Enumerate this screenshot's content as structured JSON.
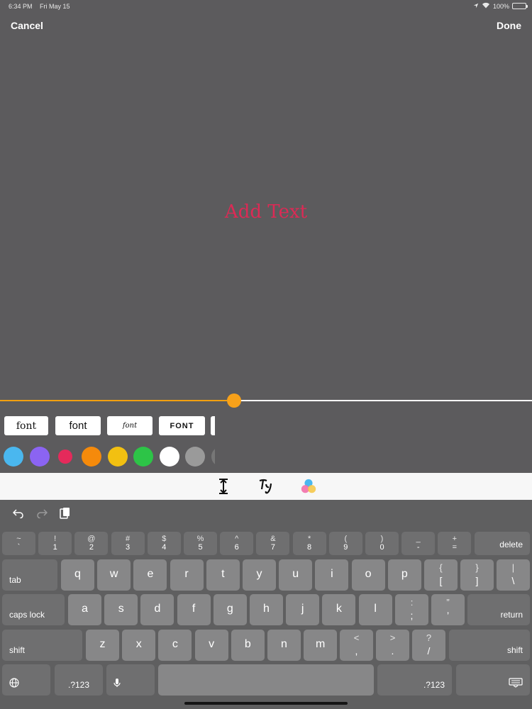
{
  "status_bar": {
    "time": "6:34 PM",
    "date": "Fri May 15",
    "battery": "100%"
  },
  "nav": {
    "cancel_label": "Cancel",
    "done_label": "Done"
  },
  "canvas": {
    "text": "Add Text",
    "text_color": "#dc2a55"
  },
  "size_slider": {
    "value_fraction": 0.44,
    "accent_color": "#f7a11a"
  },
  "font_options": [
    {
      "label": "font"
    },
    {
      "label": "font"
    },
    {
      "label": "font"
    },
    {
      "label": "FONT"
    }
  ],
  "color_swatches": [
    "#4ab7ef",
    "#8b64f2",
    "#e52a5b",
    "#f58a0b",
    "#f2c011",
    "#2dc447",
    "#ffffff",
    "#9a9a9a",
    "#777777"
  ],
  "toolbar": {
    "icons": [
      "text-height-icon",
      "font-style-icon",
      "color-palette-icon"
    ]
  },
  "keyboard": {
    "shortcut_icons": [
      "undo-icon",
      "redo-icon",
      "paste-icon"
    ],
    "row1": [
      {
        "top": "~",
        "bottom": "`"
      },
      {
        "top": "!",
        "bottom": "1"
      },
      {
        "top": "@",
        "bottom": "2"
      },
      {
        "top": "#",
        "bottom": "3"
      },
      {
        "top": "$",
        "bottom": "4"
      },
      {
        "top": "%",
        "bottom": "5"
      },
      {
        "top": "^",
        "bottom": "6"
      },
      {
        "top": "&",
        "bottom": "7"
      },
      {
        "top": "*",
        "bottom": "8"
      },
      {
        "top": "(",
        "bottom": "9"
      },
      {
        "top": ")",
        "bottom": "0"
      },
      {
        "top": "_",
        "bottom": "-"
      },
      {
        "top": "+",
        "bottom": "="
      }
    ],
    "delete_label": "delete",
    "tab_label": "tab",
    "row2": [
      "q",
      "w",
      "e",
      "r",
      "t",
      "y",
      "u",
      "i",
      "o",
      "p"
    ],
    "row2_symbols": [
      {
        "top": "{",
        "bottom": "["
      },
      {
        "top": "}",
        "bottom": "]"
      },
      {
        "top": "|",
        "bottom": "\\"
      }
    ],
    "caps_label": "caps lock",
    "row3": [
      "a",
      "s",
      "d",
      "f",
      "g",
      "h",
      "j",
      "k",
      "l"
    ],
    "row3_symbols": [
      {
        "top": ":",
        "bottom": ";"
      },
      {
        "top": "”",
        "bottom": "’"
      }
    ],
    "return_label": "return",
    "shift_label": "shift",
    "row4": [
      "z",
      "x",
      "c",
      "v",
      "b",
      "n",
      "m"
    ],
    "row4_symbols": [
      {
        "top": "<",
        "bottom": ","
      },
      {
        "top": ">",
        "bottom": "."
      },
      {
        "top": "?",
        "bottom": "/"
      }
    ],
    "numbers_label": ".?123"
  }
}
